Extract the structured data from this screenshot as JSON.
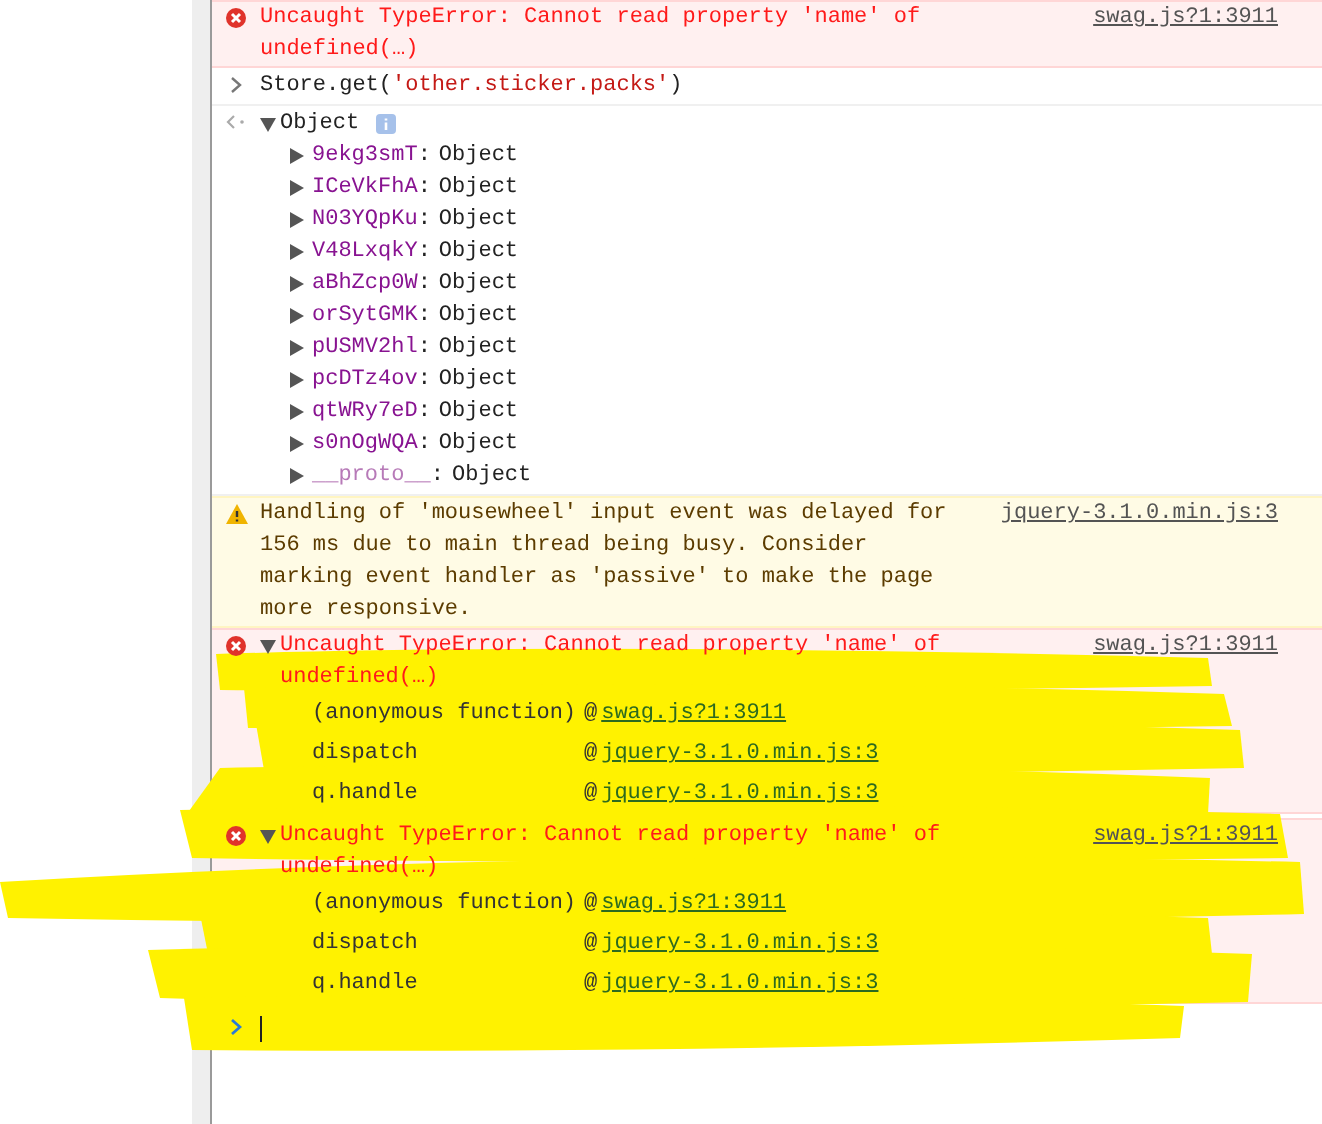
{
  "console": {
    "messages": [
      {
        "kind": "error",
        "text": "Uncaught TypeError: Cannot read property 'name' of undefined(…)",
        "source": "swag.js?1:3911"
      },
      {
        "kind": "input",
        "text": "Store.get(",
        "string": "'other.sticker.packs'",
        "close": ")"
      },
      {
        "kind": "result",
        "label": "Object",
        "expanded": true,
        "separator": ":",
        "properties": [
          {
            "key": "9ekg3smT",
            "value": "Object",
            "dimmed": false
          },
          {
            "key": "ICeVkFhA",
            "value": "Object",
            "dimmed": false
          },
          {
            "key": "N03YQpKu",
            "value": "Object",
            "dimmed": false
          },
          {
            "key": "V48LxqkY",
            "value": "Object",
            "dimmed": false
          },
          {
            "key": "aBhZcp0W",
            "value": "Object",
            "dimmed": false
          },
          {
            "key": "orSytGMK",
            "value": "Object",
            "dimmed": false
          },
          {
            "key": "pUSMV2hl",
            "value": "Object",
            "dimmed": false
          },
          {
            "key": "pcDTz4ov",
            "value": "Object",
            "dimmed": false
          },
          {
            "key": "qtWRy7eD",
            "value": "Object",
            "dimmed": false
          },
          {
            "key": "s0nOgWQA",
            "value": "Object",
            "dimmed": false
          },
          {
            "key": "__proto__",
            "value": "Object",
            "dimmed": true
          }
        ]
      },
      {
        "kind": "warning",
        "text": "Handling of 'mousewheel' input event was delayed for 156 ms due to main thread being busy. Consider marking event handler as 'passive' to make the page more responsive.",
        "source": "jquery-3.1.0.min.js:3"
      },
      {
        "kind": "error",
        "text": "Uncaught TypeError: Cannot read property 'name' of undefined(…)",
        "source": "swag.js?1:3911",
        "expanded": true,
        "stack": [
          {
            "function": "(anonymous function)",
            "at": "@",
            "location": "swag.js?1:3911"
          },
          {
            "function": "dispatch",
            "at": "@",
            "location": "jquery-3.1.0.min.js:3"
          },
          {
            "function": "q.handle",
            "at": "@",
            "location": "jquery-3.1.0.min.js:3"
          }
        ]
      },
      {
        "kind": "error",
        "text": "Uncaught TypeError: Cannot read property 'name' of undefined(…)",
        "source": "swag.js?1:3911",
        "expanded": true,
        "stack": [
          {
            "function": "(anonymous function)",
            "at": "@",
            "location": "swag.js?1:3911"
          },
          {
            "function": "dispatch",
            "at": "@",
            "location": "jquery-3.1.0.min.js:3"
          },
          {
            "function": "q.handle",
            "at": "@",
            "location": "jquery-3.1.0.min.js:3"
          }
        ]
      },
      {
        "kind": "prompt"
      }
    ]
  }
}
